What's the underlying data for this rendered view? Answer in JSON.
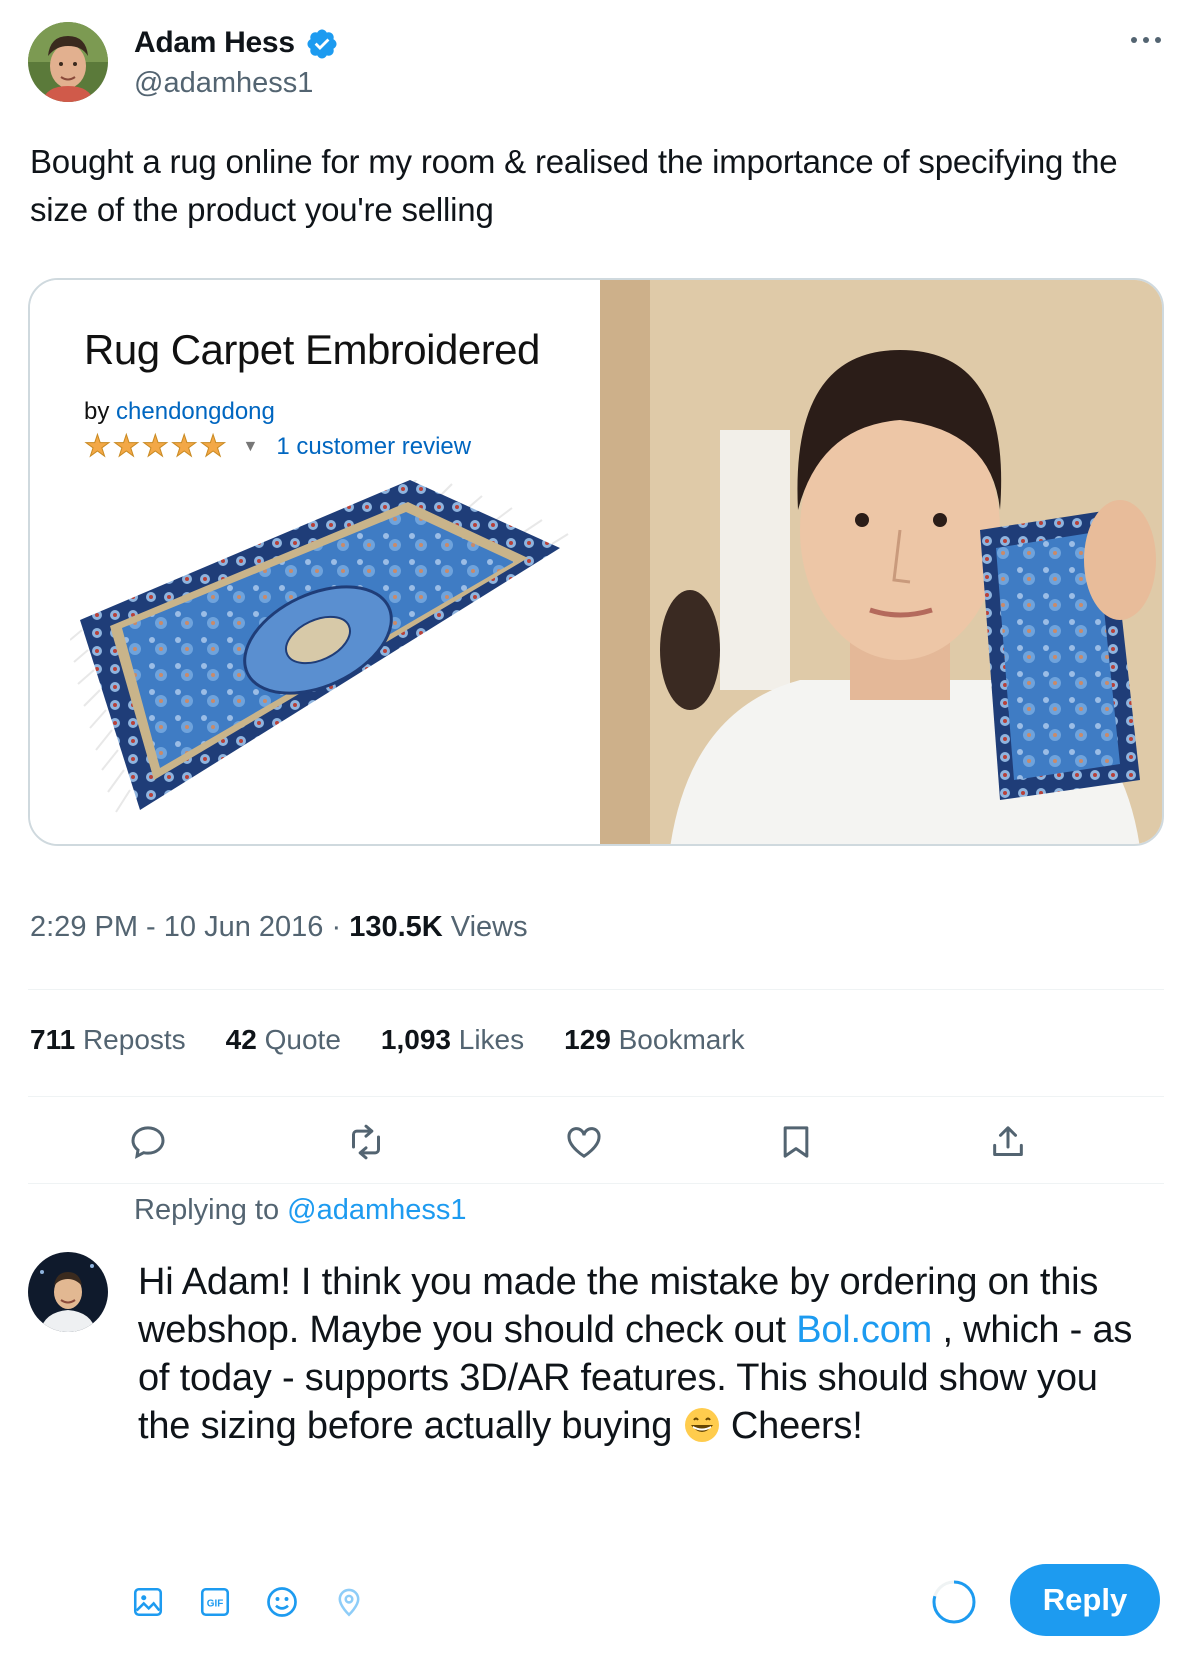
{
  "tweet": {
    "author_name": "Adam Hess",
    "author_handle": "@adamhess1",
    "text": "Bought a rug online for my room & realised the importance of specifying the size of the product you're selling",
    "media": {
      "product_title": "Rug Carpet Embroidered",
      "by_label": "by",
      "seller": "chendongdong",
      "review_label": "1 customer review",
      "star_rating": 5
    },
    "time": "2:29 PM",
    "date": "10 Jun 2016",
    "views_count": "130.5K",
    "views_label": "Views"
  },
  "stats": {
    "reposts_count": "711",
    "reposts_label": "Reposts",
    "quotes_count": "42",
    "quotes_label": "Quote",
    "likes_count": "1,093",
    "likes_label": "Likes",
    "bookmarks_count": "129",
    "bookmarks_label": "Bookmark"
  },
  "reply": {
    "replying_prefix": "Replying to",
    "replying_handle": "@adamhess1",
    "text_1": "Hi Adam! I think you made the mistake by ordering on this webshop. Maybe you should check out ",
    "link": "Bol.com",
    "text_2": " , which - as of today - supports 3D/AR features. This should show you the sizing before actually buying ",
    "text_3": " Cheers!",
    "button_label": "Reply"
  },
  "icons": {
    "verified": "verified-badge-icon",
    "more": "more-icon",
    "reply": "reply-icon",
    "repost": "repost-icon",
    "like": "heart-icon",
    "bookmark": "bookmark-icon",
    "share": "share-icon",
    "media": "image-icon",
    "gif": "gif-icon",
    "emoji": "emoji-icon",
    "location": "location-icon"
  },
  "colors": {
    "accent": "#1d9bf0",
    "secondary_text": "#536471",
    "primary_text": "#0f1419",
    "border": "#cfd9de"
  }
}
